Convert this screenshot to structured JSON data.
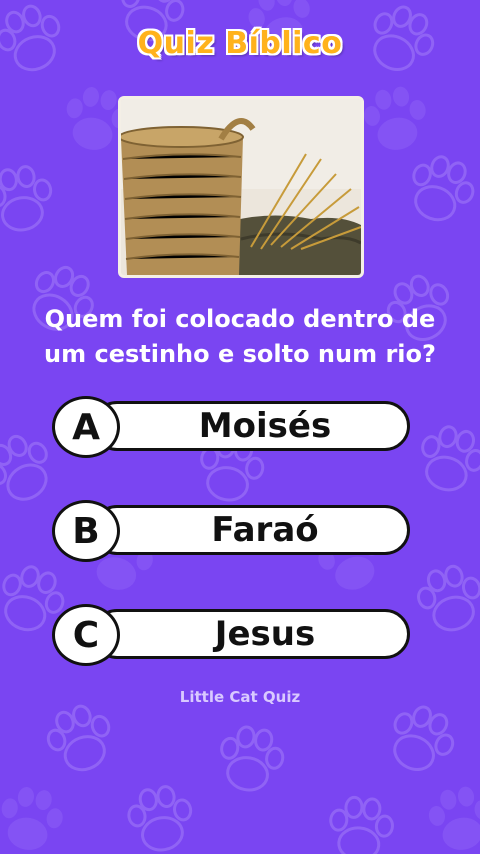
{
  "app": {
    "title": "Quiz Bíblico",
    "footer": "Little Cat Quiz"
  },
  "colors": {
    "background": "#7a45f2",
    "title": "#ffb21c",
    "option_fill": "#ffffff"
  },
  "image": {
    "description_icon": "basket-photo"
  },
  "question": {
    "line1": "Quem foi colocado dentro de",
    "line2": "um cestinho e solto num rio?"
  },
  "options": [
    {
      "letter": "A",
      "text": "Moisés"
    },
    {
      "letter": "B",
      "text": "Faraó"
    },
    {
      "letter": "C",
      "text": "Jesus"
    }
  ]
}
